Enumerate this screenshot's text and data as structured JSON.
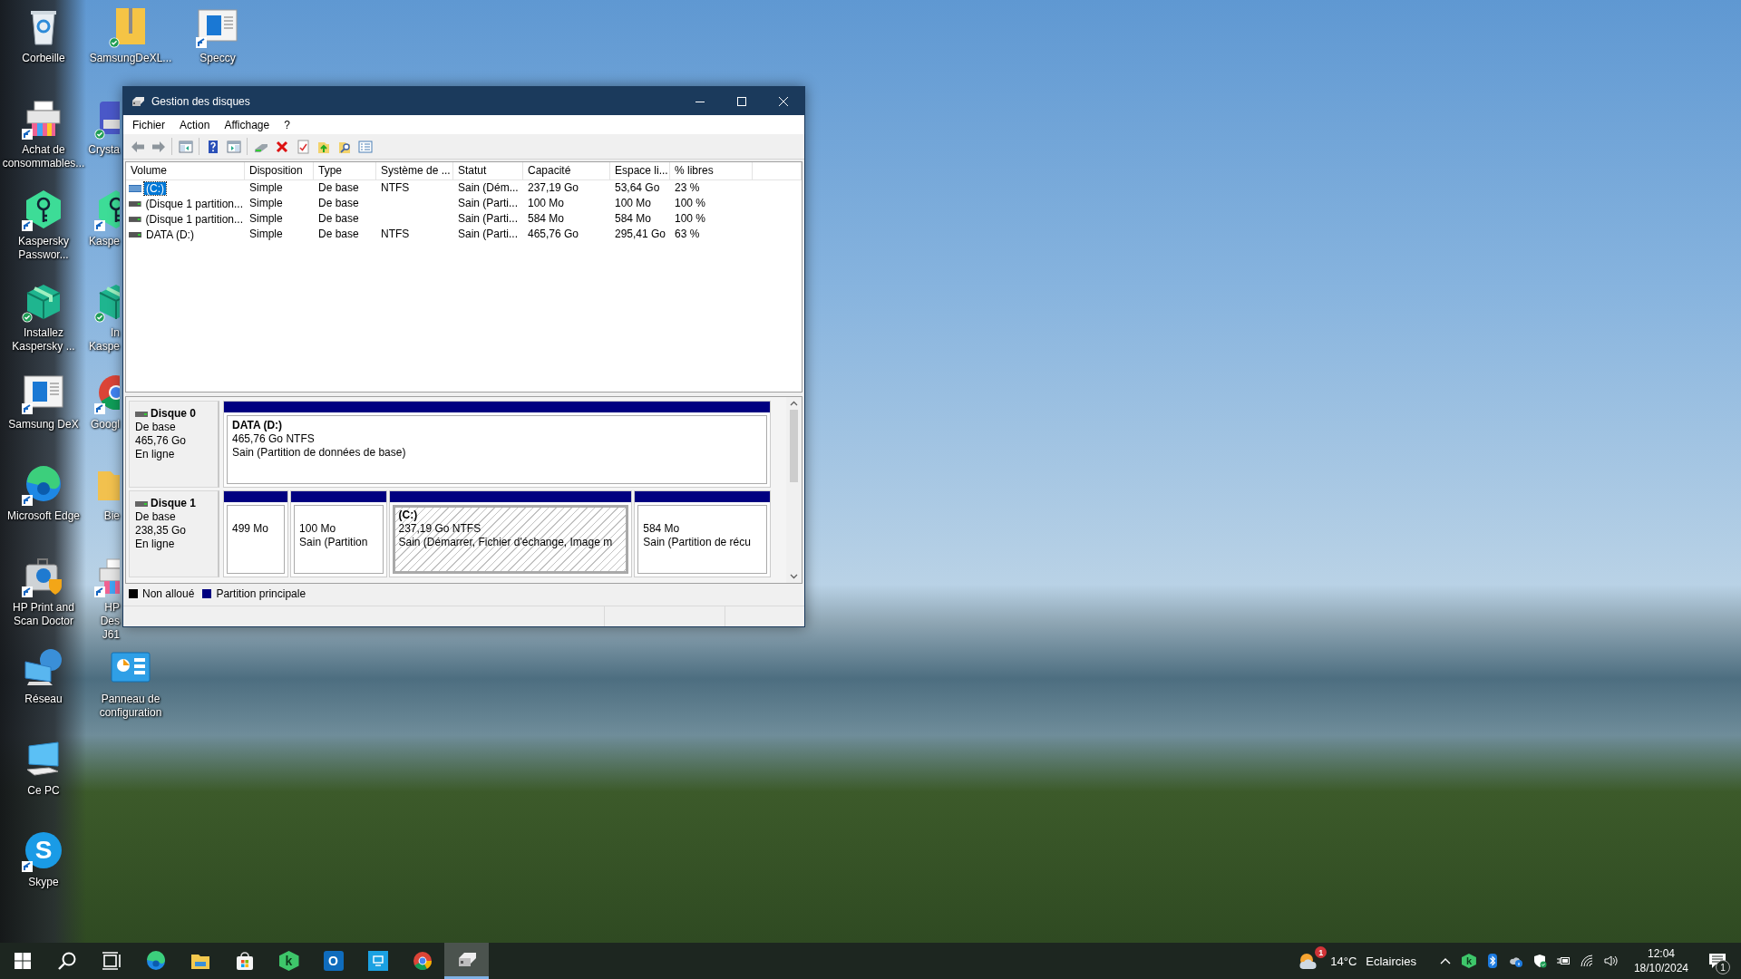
{
  "desktop": {
    "columns": [
      [
        {
          "label": "Corbeille",
          "kind": "recycle-bin",
          "shortcut": false,
          "synced": false,
          "partly_hidden": false
        },
        {
          "label": "Achat de\nconsommables...",
          "kind": "printer",
          "shortcut": true,
          "synced": false,
          "partly_hidden": false
        },
        {
          "label": "Kaspersky\nPasswor...",
          "kind": "key-hex",
          "shortcut": true,
          "synced": false,
          "partly_hidden": false
        },
        {
          "label": "Installez\nKaspersky ...",
          "kind": "box",
          "shortcut": false,
          "synced": true,
          "partly_hidden": false
        },
        {
          "label": "Samsung DeX",
          "kind": "app-window",
          "shortcut": true,
          "synced": false,
          "partly_hidden": false
        },
        {
          "label": "Microsoft Edge",
          "kind": "edge",
          "shortcut": true,
          "synced": false,
          "partly_hidden": false
        },
        {
          "label": "HP Print and\nScan Doctor",
          "kind": "hp-case",
          "shortcut": true,
          "synced": false,
          "partly_hidden": false
        },
        {
          "label": "Réseau",
          "kind": "network",
          "shortcut": false,
          "synced": false,
          "partly_hidden": false
        },
        {
          "label": "Ce PC",
          "kind": "pc",
          "shortcut": false,
          "synced": false,
          "partly_hidden": false
        },
        {
          "label": "Skype",
          "kind": "skype",
          "glyph": "S",
          "shortcut": true,
          "synced": false,
          "partly_hidden": false
        }
      ],
      [
        {
          "label": "SamsungDeXL...",
          "kind": "zip-folder",
          "shortcut": false,
          "synced": true,
          "partly_hidden": false
        },
        {
          "label": "Crysta",
          "kind": "cd-disk",
          "shortcut": false,
          "synced": true,
          "partly_hidden": true
        },
        {
          "label": "Kaspe",
          "kind": "key-hex",
          "shortcut": true,
          "synced": false,
          "partly_hidden": true
        },
        {
          "label": "In\nKaspe",
          "kind": "box",
          "shortcut": false,
          "synced": true,
          "partly_hidden": true
        },
        {
          "label": "Googl",
          "kind": "chrome",
          "shortcut": true,
          "synced": false,
          "partly_hidden": true
        },
        {
          "label": "Bie",
          "kind": "folder",
          "shortcut": false,
          "synced": false,
          "partly_hidden": true
        },
        {
          "label": "HP Des\nJ61",
          "kind": "printer",
          "shortcut": true,
          "synced": false,
          "partly_hidden": true
        },
        {
          "label": "Panneau de\nconfiguration",
          "kind": "control-panel",
          "shortcut": false,
          "synced": false,
          "partly_hidden": false
        }
      ],
      [
        {
          "label": "Speccy",
          "kind": "app-window",
          "shortcut": true,
          "synced": false,
          "partly_hidden": false
        }
      ]
    ]
  },
  "window": {
    "title": "Gestion des disques",
    "menu": [
      "Fichier",
      "Action",
      "Affichage",
      "?"
    ],
    "toolbar": [
      {
        "kind": "back"
      },
      {
        "kind": "forward"
      },
      {
        "kind": "separator"
      },
      {
        "kind": "show-tree"
      },
      {
        "kind": "separator"
      },
      {
        "kind": "help"
      },
      {
        "kind": "action-pane"
      },
      {
        "kind": "separator"
      },
      {
        "kind": "connect"
      },
      {
        "kind": "delete"
      },
      {
        "kind": "check"
      },
      {
        "kind": "folder-up"
      },
      {
        "kind": "folder-search"
      },
      {
        "kind": "properties"
      }
    ],
    "volumes": {
      "columns": [
        "Volume",
        "Disposition",
        "Type",
        "Système de ...",
        "Statut",
        "Capacité",
        "Espace li...",
        "% libres"
      ],
      "rows": [
        {
          "kind": "striped",
          "selected": true,
          "cells": [
            "(C:)",
            "Simple",
            "De base",
            "NTFS",
            "Sain (Dém...",
            "237,19 Go",
            "53,64 Go",
            "23 %"
          ]
        },
        {
          "kind": "plain",
          "selected": false,
          "cells": [
            "(Disque 1 partition...",
            "Simple",
            "De base",
            null,
            "Sain (Parti...",
            "100 Mo",
            "100 Mo",
            "100 %"
          ]
        },
        {
          "kind": "plain",
          "selected": false,
          "cells": [
            "(Disque 1 partition...",
            "Simple",
            "De base",
            null,
            "Sain (Parti...",
            "584 Mo",
            "584 Mo",
            "100 %"
          ]
        },
        {
          "kind": "plain",
          "selected": false,
          "cells": [
            "DATA (D:)",
            "Simple",
            "De base",
            "NTFS",
            "Sain (Parti...",
            "465,76 Go",
            "295,41 Go",
            "63 %"
          ]
        }
      ]
    },
    "disks": [
      {
        "name": "Disque 0",
        "type": "De base",
        "size": "465,76 Go",
        "status": "En ligne",
        "partitions": [
          {
            "kind": "primary",
            "selected": false,
            "label": "DATA  (D:)",
            "lines": [
              "465,76 Go NTFS",
              "Sain (Partition de données de base)"
            ]
          }
        ]
      },
      {
        "name": "Disque 1",
        "type": "De base",
        "size": "238,35 Go",
        "status": "En ligne",
        "partitions": [
          {
            "kind": "primary",
            "selected": false,
            "lines": [
              "499 Mo"
            ]
          },
          {
            "kind": "primary",
            "selected": false,
            "lines": [
              "100 Mo",
              "Sain (Partition"
            ]
          },
          {
            "kind": "primary",
            "selected": true,
            "label": "(C:)",
            "lines": [
              "237,19 Go NTFS",
              "Sain (Démarrer, Fichier d'échange, Image m"
            ]
          },
          {
            "kind": "primary",
            "selected": false,
            "lines": [
              "584 Mo",
              "Sain (Partition de récu"
            ]
          }
        ]
      }
    ],
    "legend": [
      {
        "label": "Non alloué",
        "color": "#000000"
      },
      {
        "label": "Partition principale",
        "color": "#000080"
      }
    ]
  },
  "taskbar": {
    "items": [
      {
        "kind": "start",
        "active": false
      },
      {
        "kind": "search",
        "active": false
      },
      {
        "kind": "task-view",
        "active": false
      },
      {
        "kind": "edge",
        "active": false
      },
      {
        "kind": "explorer",
        "active": false
      },
      {
        "kind": "store",
        "active": false
      },
      {
        "kind": "kaspersky",
        "glyph": "k",
        "active": false
      },
      {
        "kind": "outlook",
        "glyph": "O",
        "active": false
      },
      {
        "kind": "remote",
        "active": false
      },
      {
        "kind": "chrome",
        "active": false
      },
      {
        "kind": "disk-manager",
        "active": true
      }
    ],
    "weather": {
      "temperature": "14°C",
      "condition": "Eclaircies",
      "badge": "1"
    },
    "tray_icons": [
      {
        "kind": "chevron"
      },
      {
        "kind": "kaspersky",
        "glyph": "k"
      },
      {
        "kind": "bluetooth"
      },
      {
        "kind": "cloud-info"
      },
      {
        "kind": "shield"
      },
      {
        "kind": "battery"
      },
      {
        "kind": "wifi"
      },
      {
        "kind": "volume"
      }
    ],
    "clock": {
      "time": "12:04",
      "date": "18/10/2024"
    },
    "notifications": {
      "badge": "1"
    }
  }
}
